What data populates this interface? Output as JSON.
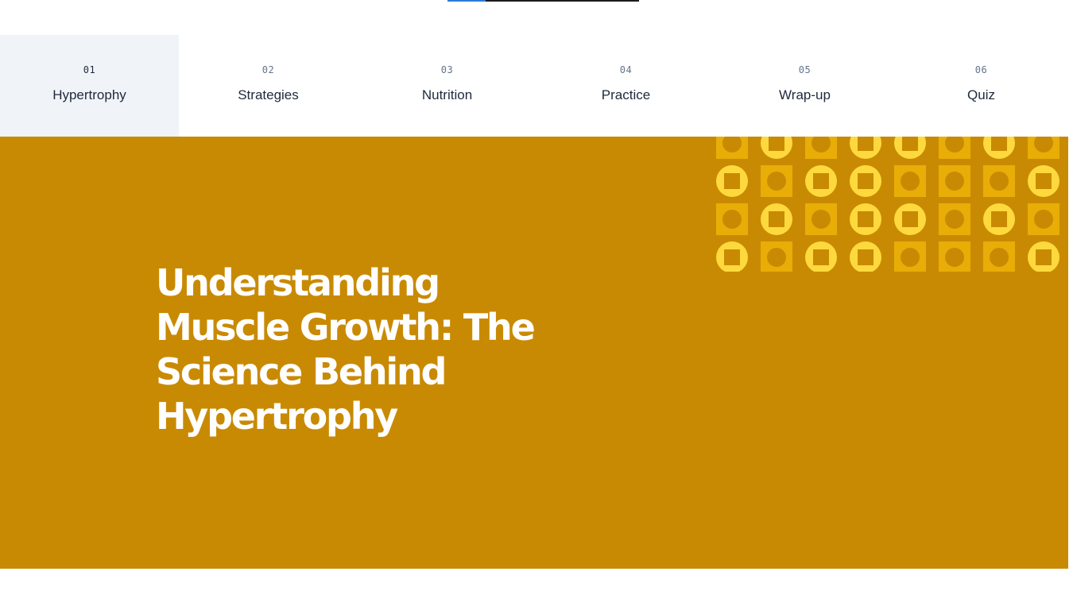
{
  "progress": {
    "fraction": 0.2
  },
  "tabs": [
    {
      "number": "01",
      "label": "Hypertrophy",
      "active": true
    },
    {
      "number": "02",
      "label": "Strategies",
      "active": false
    },
    {
      "number": "03",
      "label": "Nutrition",
      "active": false
    },
    {
      "number": "04",
      "label": "Practice",
      "active": false
    },
    {
      "number": "05",
      "label": "Wrap-up",
      "active": false
    },
    {
      "number": "06",
      "label": "Quiz",
      "active": false
    }
  ],
  "hero": {
    "title": "Understanding Muscle Growth: The Science Behind Hypertrophy",
    "background_color": "#c98a03"
  },
  "pattern": {
    "colors": {
      "square": "#e8ad07",
      "circle": "#fdd93d",
      "hole": "#c98a03"
    },
    "rows": [
      [
        "square",
        "circle",
        "square",
        "circle",
        "circle",
        "square",
        "circle",
        "square"
      ],
      [
        "circle",
        "square",
        "circle",
        "circle",
        "square",
        "square",
        "square",
        "circle"
      ],
      [
        "square",
        "circle",
        "square",
        "circle",
        "circle",
        "square",
        "circle",
        "square"
      ],
      [
        "circle",
        "square",
        "circle",
        "circle",
        "square",
        "square",
        "square",
        "circle"
      ]
    ]
  }
}
